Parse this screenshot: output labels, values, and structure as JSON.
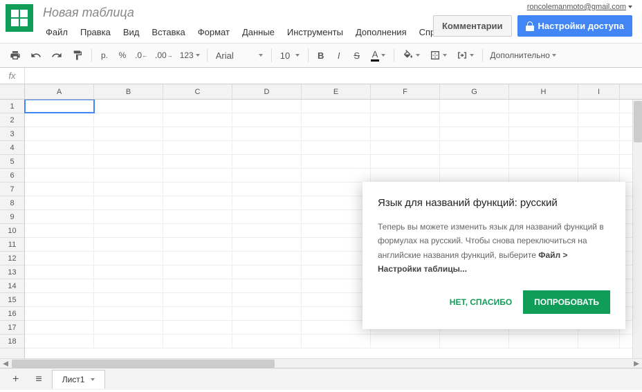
{
  "user_email": "roncolemanmoto@gmail.com",
  "doc_title": "Новая таблица",
  "menu": [
    "Файл",
    "Правка",
    "Вид",
    "Вставка",
    "Формат",
    "Данные",
    "Инструменты",
    "Дополнения",
    "Справка"
  ],
  "header_buttons": {
    "comments": "Комментарии",
    "share": "Настройки доступа"
  },
  "toolbar": {
    "currency": "р.",
    "percent": "%",
    "dec_dec": ".0",
    "dec_inc": ".00",
    "num_format": "123",
    "font": "Arial",
    "font_size": "10",
    "more": "Дополнительно"
  },
  "formula_bar": {
    "label": "fx",
    "value": ""
  },
  "columns": [
    "A",
    "B",
    "C",
    "D",
    "E",
    "F",
    "G",
    "H",
    "I"
  ],
  "rows": [
    1,
    2,
    3,
    4,
    5,
    6,
    7,
    8,
    9,
    10,
    11,
    12,
    13,
    14,
    15,
    16,
    17,
    18
  ],
  "active_cell": "A1",
  "sheet_tabs": {
    "sheet1": "Лист1"
  },
  "popup": {
    "title": "Язык для названий функций: русский",
    "body_1": "Теперь вы можете изменить язык для названий функций в формулах на русский. Чтобы снова переключиться на английские названия функций, выберите ",
    "body_bold": "Файл > Настройки таблицы...",
    "dismiss": "НЕТ, СПАСИБО",
    "try": "ПОПРОБОВАТЬ"
  }
}
